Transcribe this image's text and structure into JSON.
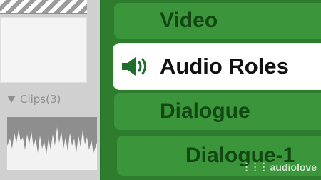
{
  "left_panel": {
    "clips_label": "Clips(3)"
  },
  "roles": {
    "items": [
      {
        "label": "Video",
        "selected": false
      },
      {
        "label": "Audio Roles",
        "selected": true,
        "icon": "speaker-icon"
      },
      {
        "label": "Dialogue",
        "selected": false
      },
      {
        "label": "Dialogue-1",
        "selected": false
      }
    ]
  },
  "watermark": {
    "text": "audiolove"
  },
  "colors": {
    "panel_green": "#2e7d2e",
    "row_green": "#3b963b",
    "text_dark_green": "#134713",
    "selected_bg": "#ffffff"
  }
}
